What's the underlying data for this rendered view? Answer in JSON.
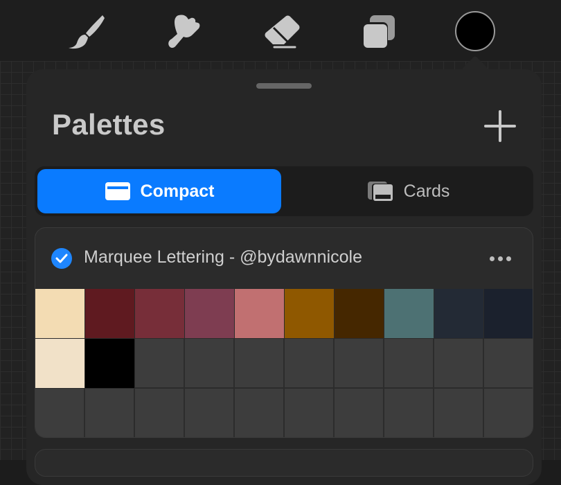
{
  "toolbar": {
    "tools": [
      {
        "icon": "brush-icon"
      },
      {
        "icon": "smudge-icon"
      },
      {
        "icon": "eraser-icon"
      },
      {
        "icon": "layers-icon"
      },
      {
        "icon": "color-swatch-icon",
        "color": "#000000"
      }
    ]
  },
  "panel": {
    "title": "Palettes",
    "add_icon": "plus-icon",
    "view_modes": [
      {
        "label": "Compact",
        "icon": "compact-view-icon",
        "selected": true
      },
      {
        "label": "Cards",
        "icon": "cards-view-icon",
        "selected": false
      }
    ],
    "palettes": [
      {
        "name": "Marquee Lettering - @bydawnnicole",
        "default": true,
        "swatches": [
          "#f3dcb3",
          "#5f1a20",
          "#772e39",
          "#7e3d51",
          "#c17071",
          "#8f5800",
          "#452700",
          "#4d7173",
          "#232a35",
          "#1b212d",
          "#f1e1c8",
          "#000000",
          null,
          null,
          null,
          null,
          null,
          null,
          null,
          null,
          null,
          null,
          null,
          null,
          null,
          null,
          null,
          null,
          null,
          null
        ]
      }
    ]
  },
  "colors": {
    "accent": "#0a7bff",
    "panel_bg": "#262626",
    "empty_swatch": "#3d3d3d"
  }
}
